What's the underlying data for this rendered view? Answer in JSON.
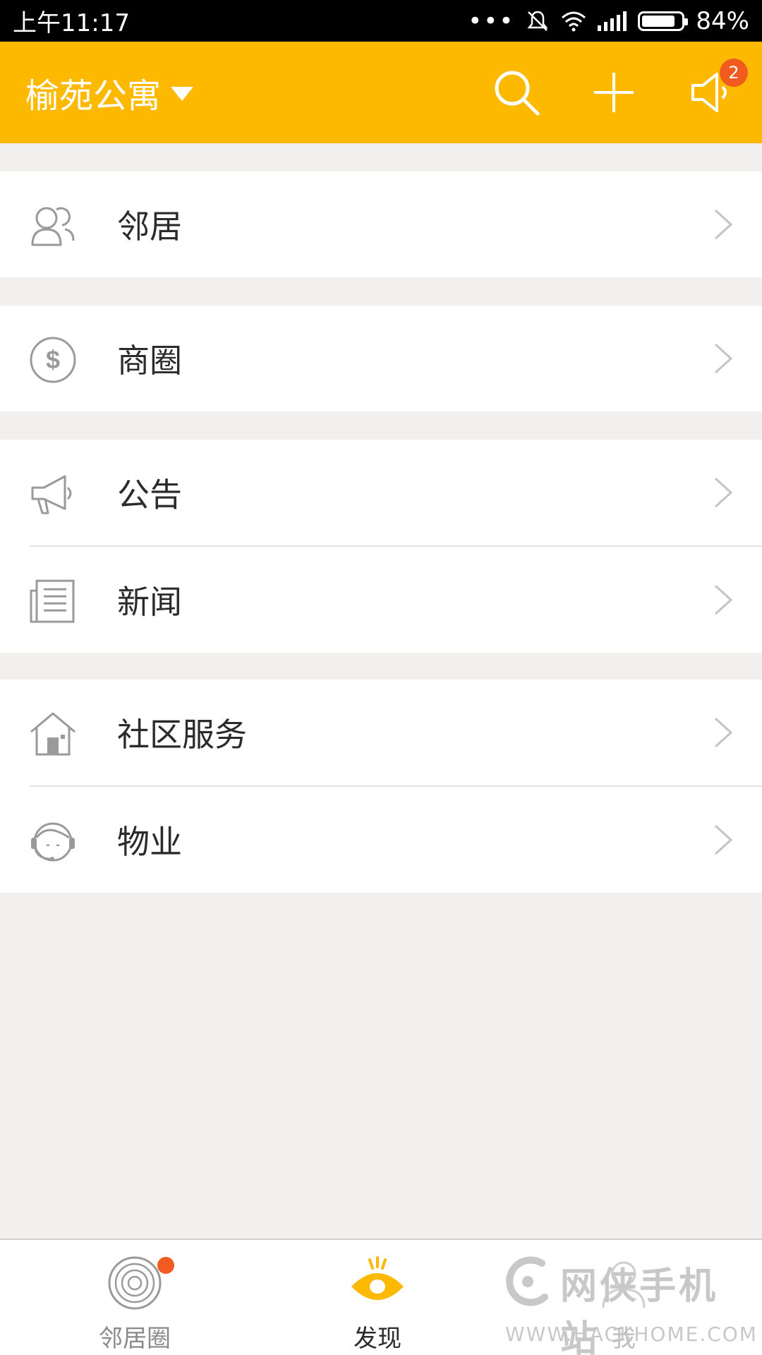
{
  "status_bar": {
    "time": "上午11:17",
    "battery": "84%"
  },
  "header": {
    "community_name": "榆苑公寓",
    "notification_count": "2"
  },
  "menu_groups": [
    {
      "items": [
        {
          "label": "邻居",
          "icon": "neighbors-icon"
        }
      ]
    },
    {
      "items": [
        {
          "label": "商圈",
          "icon": "dollar-coin-icon"
        }
      ]
    },
    {
      "items": [
        {
          "label": "公告",
          "icon": "megaphone-icon"
        },
        {
          "label": "新闻",
          "icon": "newspaper-icon"
        }
      ]
    },
    {
      "items": [
        {
          "label": "社区服务",
          "icon": "house-icon"
        },
        {
          "label": "物业",
          "icon": "headset-agent-icon"
        }
      ]
    }
  ],
  "bottom_nav": [
    {
      "label": "邻居圈",
      "icon": "ripple-circle-icon",
      "has_dot": true
    },
    {
      "label": "发现",
      "icon": "eye-icon",
      "active": true
    },
    {
      "label": "我",
      "icon": "person-icon"
    }
  ],
  "watermark": {
    "title": "网侠手机站",
    "url": "WWW.HACKHOME.COM"
  },
  "colors": {
    "accent": "#fcb900",
    "badge": "#f25b1f",
    "background": "#f1f0ef"
  }
}
